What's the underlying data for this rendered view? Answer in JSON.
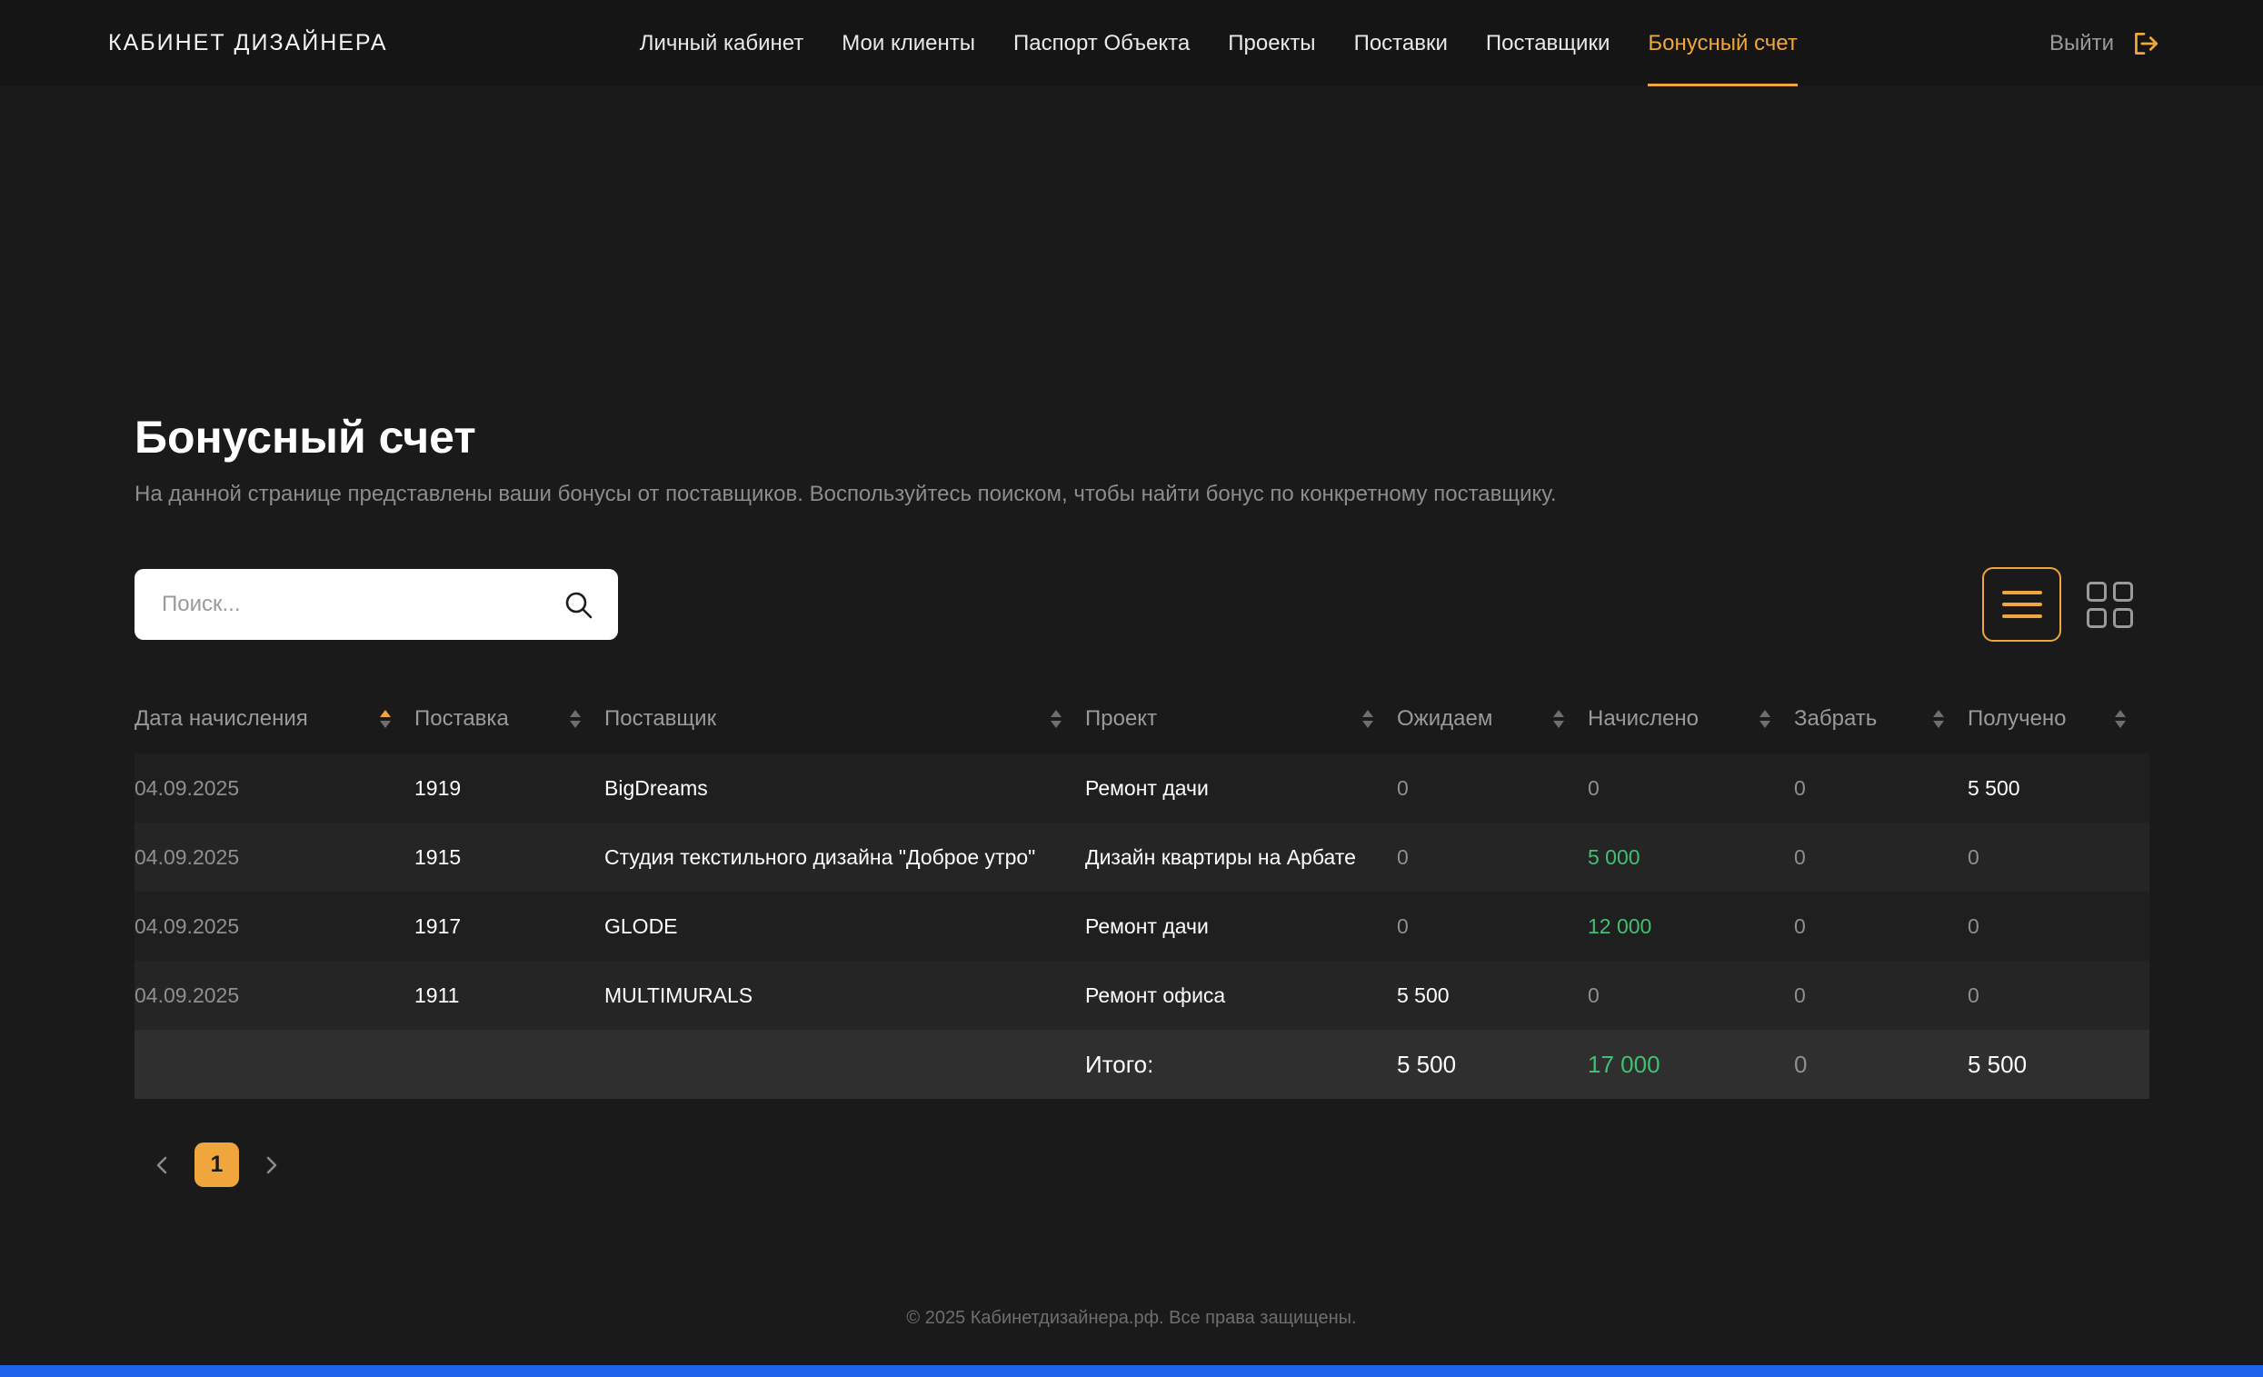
{
  "header": {
    "logo": "КАБИНЕТ ДИЗАЙНЕРА",
    "nav": [
      {
        "label": "Личный кабинет",
        "active": false
      },
      {
        "label": "Мои клиенты",
        "active": false
      },
      {
        "label": "Паспорт Объекта",
        "active": false
      },
      {
        "label": "Проекты",
        "active": false
      },
      {
        "label": "Поставки",
        "active": false
      },
      {
        "label": "Поставщики",
        "active": false
      },
      {
        "label": "Бонусный счет",
        "active": true
      }
    ],
    "logout_label": "Выйти"
  },
  "page": {
    "title": "Бонусный счет",
    "subtitle": "На данной странице представлены ваши бонусы от поставщиков. Воспользуйтесь поиском, чтобы найти бонус по конкретному поставщику."
  },
  "search": {
    "placeholder": "Поиск..."
  },
  "table": {
    "columns": [
      "Дата начисления",
      "Поставка",
      "Поставщик",
      "Проект",
      "Ожидаем",
      "Начислено",
      "Забрать",
      "Получено"
    ],
    "sorted_column": "Дата начисления",
    "sort_direction": "asc",
    "rows": [
      {
        "date": "04.09.2025",
        "delivery": "1919",
        "supplier": "BigDreams",
        "project": "Ремонт дачи",
        "expected": "0",
        "accrued": "0",
        "takeout": "0",
        "received": "5 500"
      },
      {
        "date": "04.09.2025",
        "delivery": "1915",
        "supplier": "Студия текстильного дизайна \"Доброе утро\"",
        "project": "Дизайн квартиры на Арбате",
        "expected": "0",
        "accrued": "5 000",
        "takeout": "0",
        "received": "0"
      },
      {
        "date": "04.09.2025",
        "delivery": "1917",
        "supplier": "GLODE",
        "project": "Ремонт дачи",
        "expected": "0",
        "accrued": "12 000",
        "takeout": "0",
        "received": "0"
      },
      {
        "date": "04.09.2025",
        "delivery": "1911",
        "supplier": "MULTIMURALS",
        "project": "Ремонт офиса",
        "expected": "5 500",
        "accrued": "0",
        "takeout": "0",
        "received": "0"
      }
    ],
    "totals": {
      "label": "Итого:",
      "expected": "5 500",
      "accrued": "17 000",
      "takeout": "0",
      "received": "5 500"
    }
  },
  "pagination": {
    "current": "1"
  },
  "footer": {
    "copyright": "© 2025 Кабинетдизайнера.рф. Все права защищены."
  },
  "colors": {
    "accent": "#efa63c",
    "green": "#40c073",
    "background": "#1a1a1a",
    "bottom_strip": "#1e63e9"
  }
}
